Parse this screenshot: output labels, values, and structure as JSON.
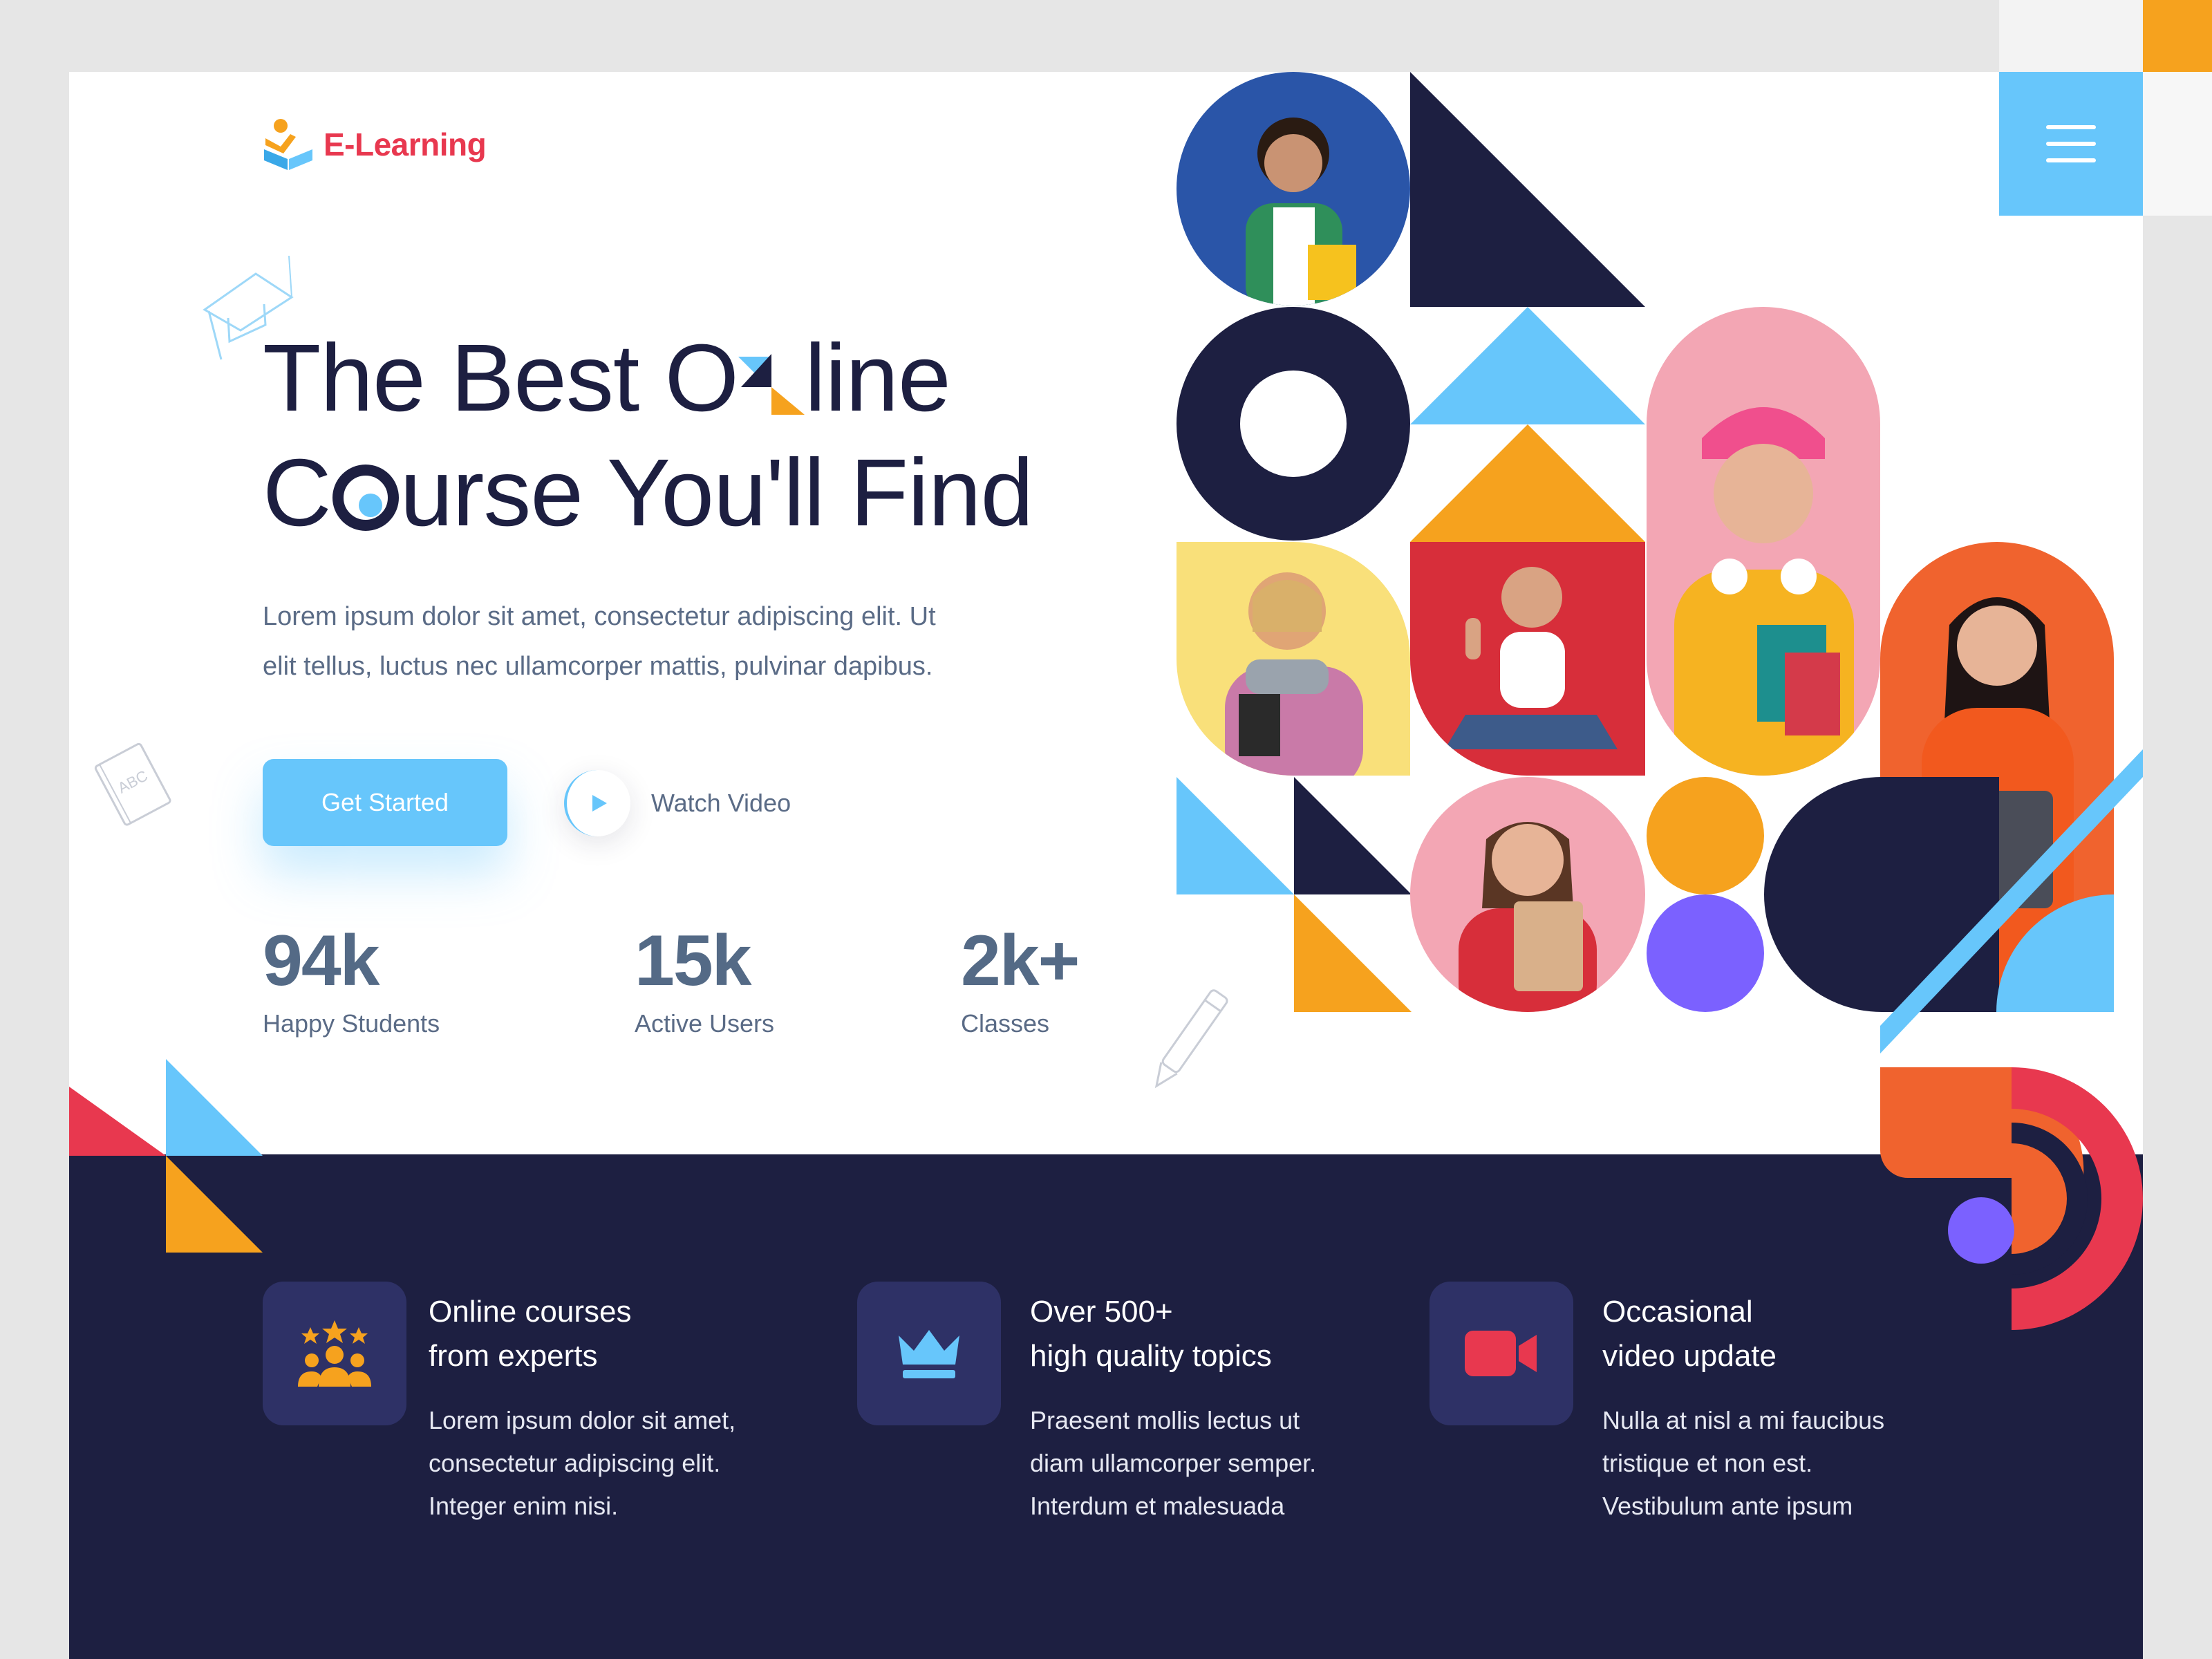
{
  "logo": {
    "text": "E-Learning"
  },
  "hero": {
    "title_part1": "The Best O",
    "title_part2": "line",
    "title_line2_part1": "C",
    "title_line2_part2": "urse You'll Find",
    "description_line1": "Lorem ipsum dolor sit amet, consectetur adipiscing elit. Ut",
    "description_line2": "elit tellus, luctus nec ullamcorper mattis, pulvinar dapibus.",
    "cta_label": "Get Started",
    "video_label": "Watch Video"
  },
  "stats": [
    {
      "value": "94k",
      "label": "Happy Students"
    },
    {
      "value": "15k",
      "label": "Active Users"
    },
    {
      "value": "2k+",
      "label": "Classes"
    }
  ],
  "features": [
    {
      "title_line1": "Online courses",
      "title_line2": "from experts",
      "text_line1": "Lorem ipsum dolor sit amet,",
      "text_line2": "consectetur adipiscing elit.",
      "text_line3": "Integer enim nisi.",
      "icon": "users-stars-icon"
    },
    {
      "title_line1": "Over 500+",
      "title_line2": "high quality topics",
      "text_line1": "Praesent mollis lectus ut",
      "text_line2": "diam ullamcorper semper.",
      "text_line3": "Interdum et malesuada",
      "icon": "crown-icon"
    },
    {
      "title_line1": "Occasional",
      "title_line2": "video update",
      "text_line1": "Nulla at nisl a mi faucibus",
      "text_line2": "tristique et non est.",
      "text_line3": "Vestibulum ante ipsum",
      "icon": "video-camera-icon"
    }
  ],
  "colors": {
    "navy": "#1d1f41",
    "sky": "#67c6fb",
    "orange": "#f6a21e",
    "red": "#e8384f",
    "purple": "#7b61ff",
    "accent_text": "#546a86"
  }
}
